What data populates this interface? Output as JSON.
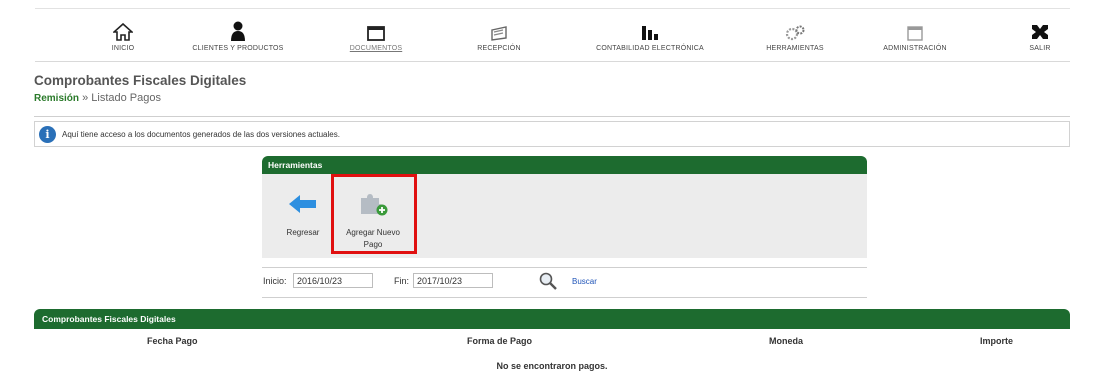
{
  "nav": {
    "items": [
      {
        "label": "INICIO",
        "icon": "home-icon"
      },
      {
        "label": "CLIENTES Y PRODUCTOS",
        "icon": "user-icon"
      },
      {
        "label": "DOCUMENTOS",
        "icon": "folder-icon"
      },
      {
        "label": "RECEPCIÓN",
        "icon": "inbox-icon"
      },
      {
        "label": "CONTABILIDAD ELECTRÓNICA",
        "icon": "bar-chart-icon"
      },
      {
        "label": "HERRAMIENTAS",
        "icon": "gears-icon"
      },
      {
        "label": "ADMINISTRACIÓN",
        "icon": "calendar-icon"
      },
      {
        "label": "SALIR",
        "icon": "exit-icon"
      }
    ],
    "active": "DOCUMENTOS"
  },
  "header": {
    "title": "Comprobantes Fiscales Digitales",
    "breadcrumb_link": "Remisión",
    "breadcrumb_sep": "»",
    "breadcrumb_current": "Listado Pagos"
  },
  "info": {
    "icon": "info-icon",
    "text": "Aquí tiene acceso a los documentos generados de las dos versiones actuales."
  },
  "tools": {
    "title": "Herramientas",
    "back_label": "Regresar",
    "add_label_line1": "Agregar Nuevo",
    "add_label_line2": "Pago"
  },
  "filters": {
    "start_label": "Inicio:",
    "start_value": "2016/10/23",
    "end_label": "Fin:",
    "end_value": "2017/10/23",
    "search_label": "Buscar"
  },
  "results": {
    "title": "Comprobantes Fiscales Digitales",
    "columns": [
      "Fecha Pago",
      "Forma de Pago",
      "Moneda",
      "Importe"
    ],
    "empty_message": "No se encontraron pagos."
  },
  "colors": {
    "brand_green": "#1d6b2f",
    "highlight_red": "#e01010",
    "info_blue": "#2a70b8",
    "link_blue": "#1f54b8"
  }
}
